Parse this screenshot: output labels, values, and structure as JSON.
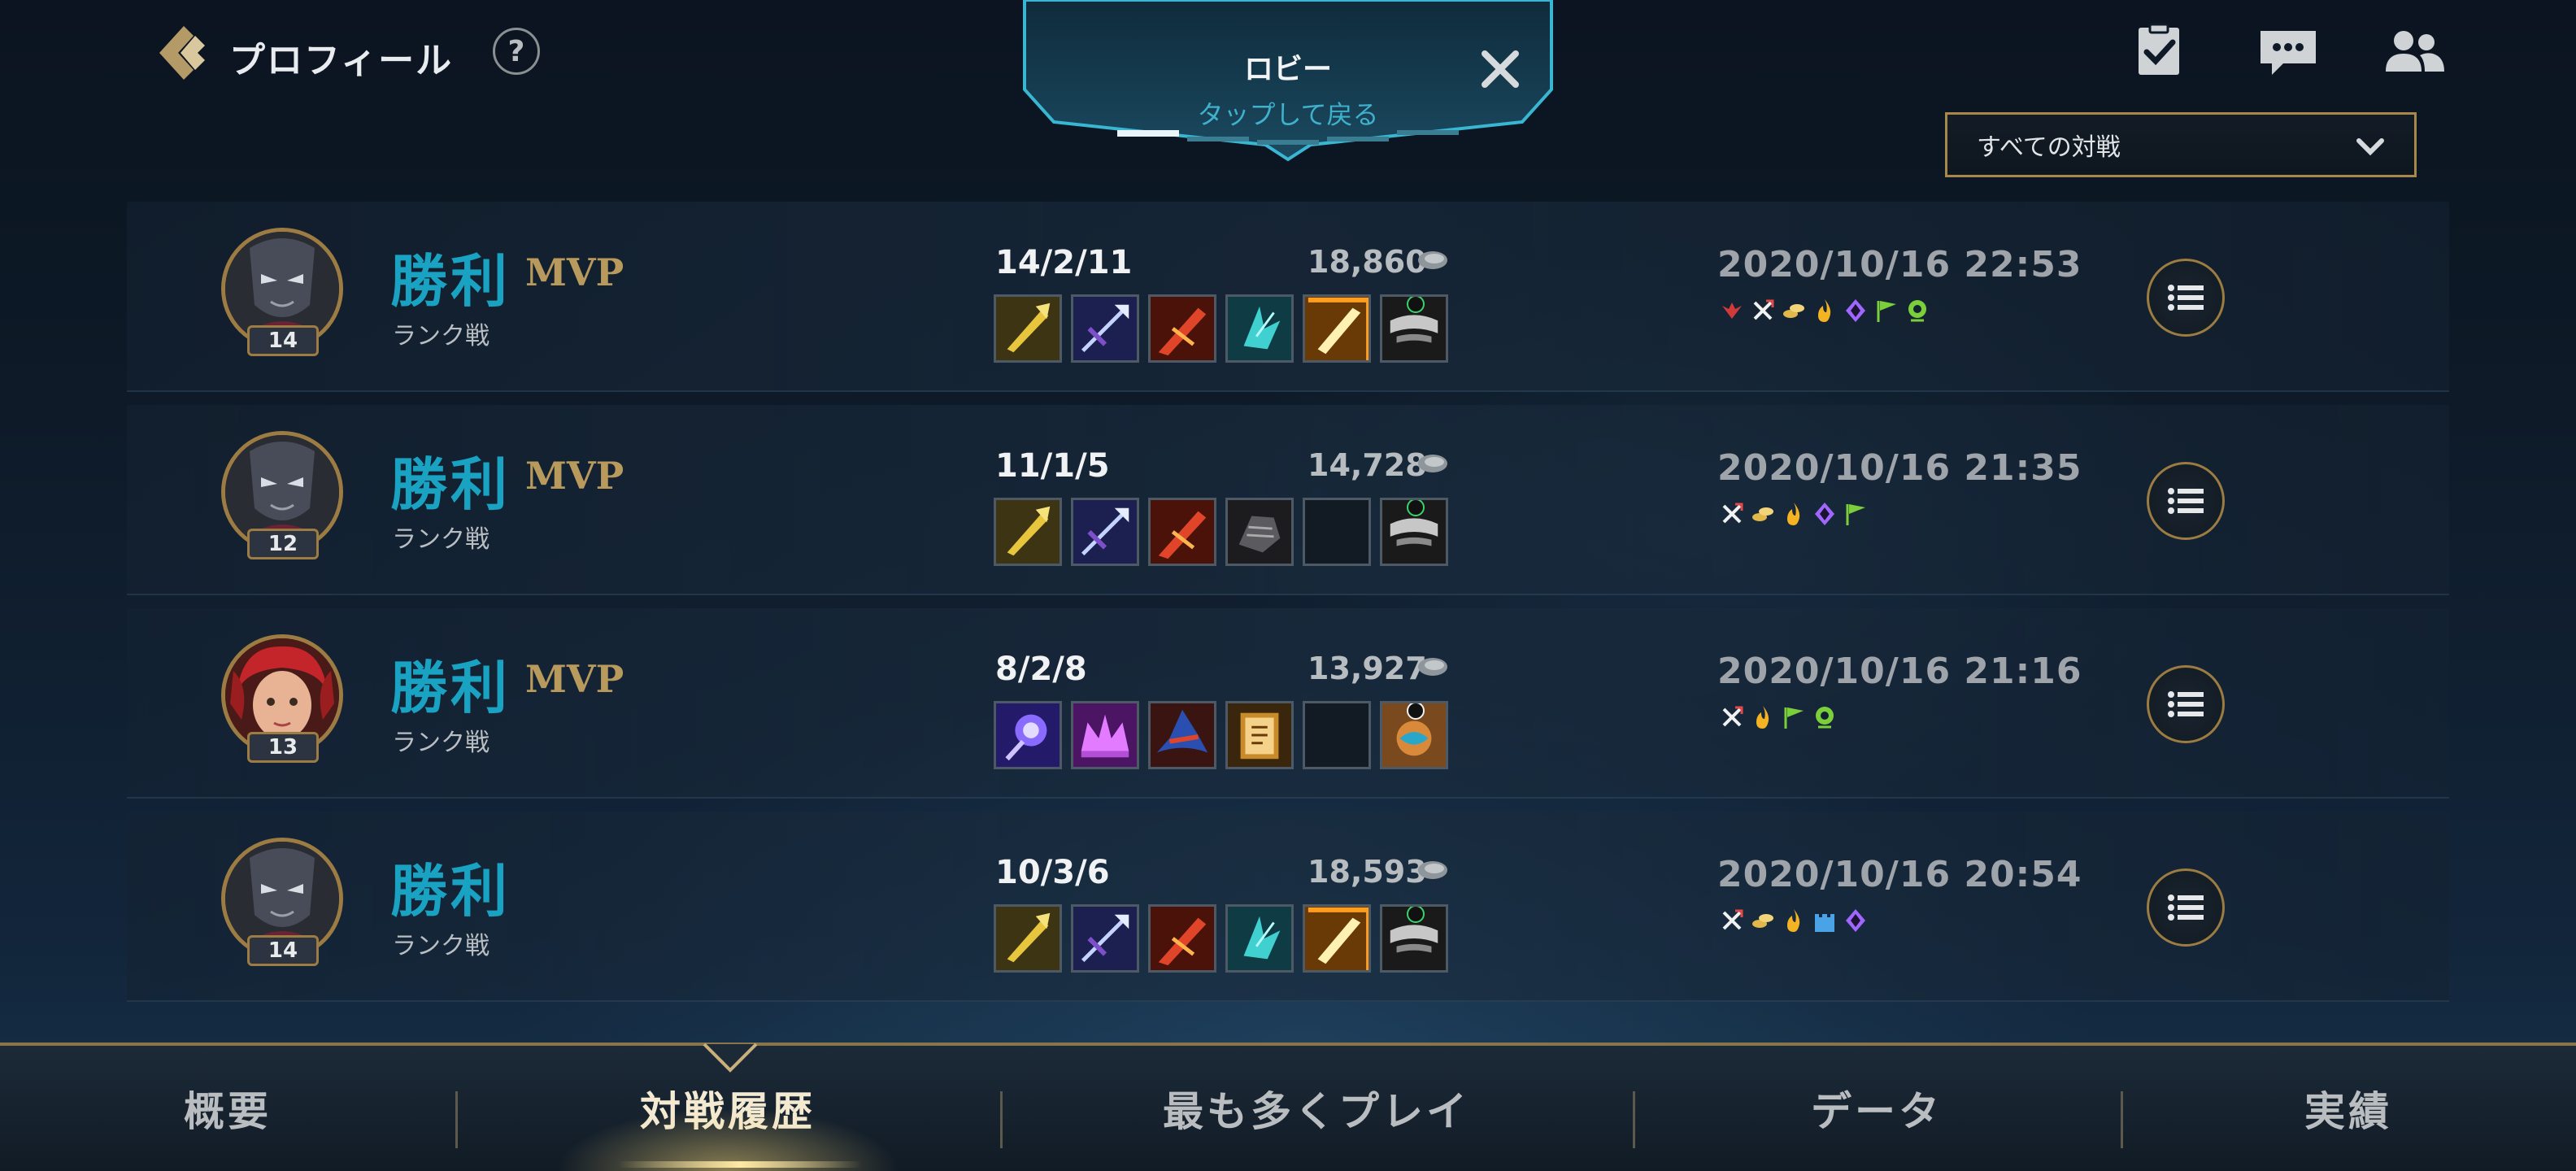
{
  "header": {
    "title": "プロフィール",
    "help_label": "?"
  },
  "lobby": {
    "title": "ロビー",
    "subtitle": "タップして戻る"
  },
  "filter": {
    "selected": "すべての対戦"
  },
  "matches": [
    {
      "result": "勝利",
      "mvp": "MVP",
      "mode": "ランク戦",
      "level": "14",
      "kda": "14/2/11",
      "gold": "18,860",
      "datetime": "2020/10/16 22:53",
      "champion": "champion-dark",
      "items": [
        "item-gold-spear",
        "item-blue-arrow",
        "item-red-blade",
        "item-teal-shard",
        "item-gold-sword",
        "item-trinket-mask"
      ],
      "badges": [
        "red-wings",
        "sword-cross",
        "gold-coins",
        "flame",
        "purple-gem",
        "green-flag",
        "green-eye"
      ]
    },
    {
      "result": "勝利",
      "mvp": "MVP",
      "mode": "ランク戦",
      "level": "12",
      "kda": "11/1/5",
      "gold": "14,728",
      "datetime": "2020/10/16 21:35",
      "champion": "champion-dark",
      "items": [
        "item-gold-spear",
        "item-blue-arrow",
        "item-red-blade",
        "item-dark-gauntlet",
        "empty",
        "item-trinket-mask"
      ],
      "badges": [
        "sword-cross",
        "gold-coins",
        "flame",
        "purple-gem",
        "green-flag"
      ]
    },
    {
      "result": "勝利",
      "mvp": "MVP",
      "mode": "ランク戦",
      "level": "13",
      "kda": "8/2/8",
      "gold": "13,927",
      "datetime": "2020/10/16 21:16",
      "champion": "champion-red",
      "items": [
        "item-purple-orb",
        "item-pink-crown",
        "item-red-hat",
        "item-gold-tome",
        "empty",
        "item-trinket-orange"
      ],
      "badges": [
        "sword-cross",
        "flame",
        "green-flag",
        "green-eye"
      ]
    },
    {
      "result": "勝利",
      "mvp": "",
      "mode": "ランク戦",
      "level": "14",
      "kda": "10/3/6",
      "gold": "18,593",
      "datetime": "2020/10/16 20:54",
      "champion": "champion-dark",
      "items": [
        "item-gold-spear",
        "item-blue-arrow",
        "item-red-blade",
        "item-teal-shard",
        "item-gold-sword",
        "item-trinket-mask"
      ],
      "badges": [
        "sword-cross",
        "gold-coins",
        "flame",
        "blue-tower",
        "purple-gem"
      ]
    }
  ],
  "tabs": [
    {
      "label": "概要"
    },
    {
      "label": "対戦履歴",
      "active": true
    },
    {
      "label": "最も多くプレイ"
    },
    {
      "label": "データ"
    },
    {
      "label": "実績"
    }
  ],
  "colors": {
    "accent_gold": "#9c7c42",
    "result_blue": "#19a2c2",
    "mvp_gold": "#b79a5c",
    "background": "#0e1a28"
  },
  "icons": {
    "back": "chevron-left-icon",
    "help": "help-circle-icon",
    "close": "close-icon",
    "missions": "clipboard-check-icon",
    "chat": "chat-bubble-icon",
    "friends": "friends-icon",
    "dropdown": "chevron-down-icon",
    "detail": "list-icon"
  }
}
